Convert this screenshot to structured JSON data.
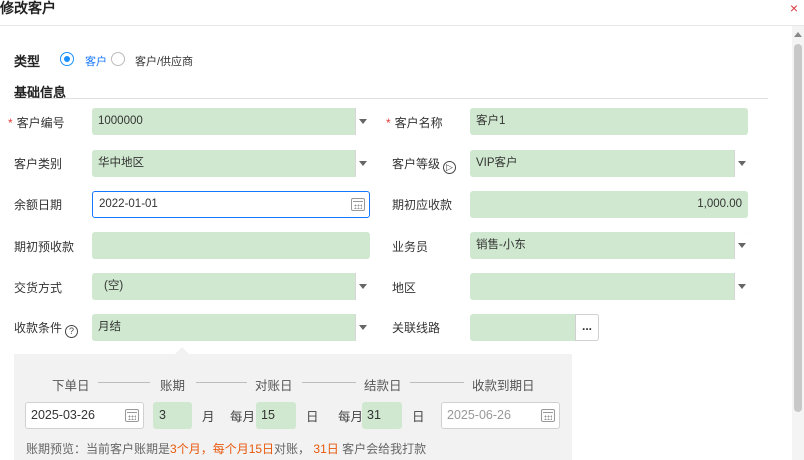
{
  "dialog": {
    "title": "修改客户",
    "close": "×"
  },
  "type_row": {
    "label": "类型",
    "options": [
      "客户",
      "客户/供应商"
    ],
    "selected": "客户"
  },
  "section": {
    "title": "基础信息"
  },
  "fields": {
    "customer_code": {
      "label": "客户编号",
      "value": "1000000",
      "required": true
    },
    "customer_name": {
      "label": "客户名称",
      "value": "客户1",
      "required": true
    },
    "customer_category": {
      "label": "客户类别",
      "value": "华中地区"
    },
    "customer_level": {
      "label": "客户等级",
      "value": "VIP客户"
    },
    "balance_date": {
      "label": "余额日期",
      "value": "2022-01-01"
    },
    "initial_receivable": {
      "label": "期初应收款",
      "value": "1,000.00"
    },
    "initial_prepaid": {
      "label": "期初预收款",
      "value": ""
    },
    "salesperson": {
      "label": "业务员",
      "value": "销售-小东"
    },
    "delivery_method": {
      "label": "交货方式",
      "value": "(空)"
    },
    "region": {
      "label": "地区",
      "value": ""
    },
    "payment_terms": {
      "label": "收款条件",
      "value": "月结"
    },
    "related_route": {
      "label": "关联线路",
      "value": "",
      "button": "..."
    }
  },
  "period_panel": {
    "steps": [
      "下单日",
      "账期",
      "对账日",
      "结款日",
      "收款到期日"
    ],
    "order_date": "2025-03-26",
    "period_months": "3",
    "month_unit": "月",
    "every_month_1": "每月",
    "statement_day": "15",
    "day_unit_1": "日",
    "every_month_2": "每月",
    "settle_day": "31",
    "day_unit_2": "日",
    "due_date": "2025-06-26",
    "preview": {
      "prefix": "账期预览：当前客户账期是",
      "highlight1": "3个月，每个月15日",
      "mid": "对账，",
      "highlight2": "31日",
      "suffix": "客户会给我打款"
    }
  }
}
